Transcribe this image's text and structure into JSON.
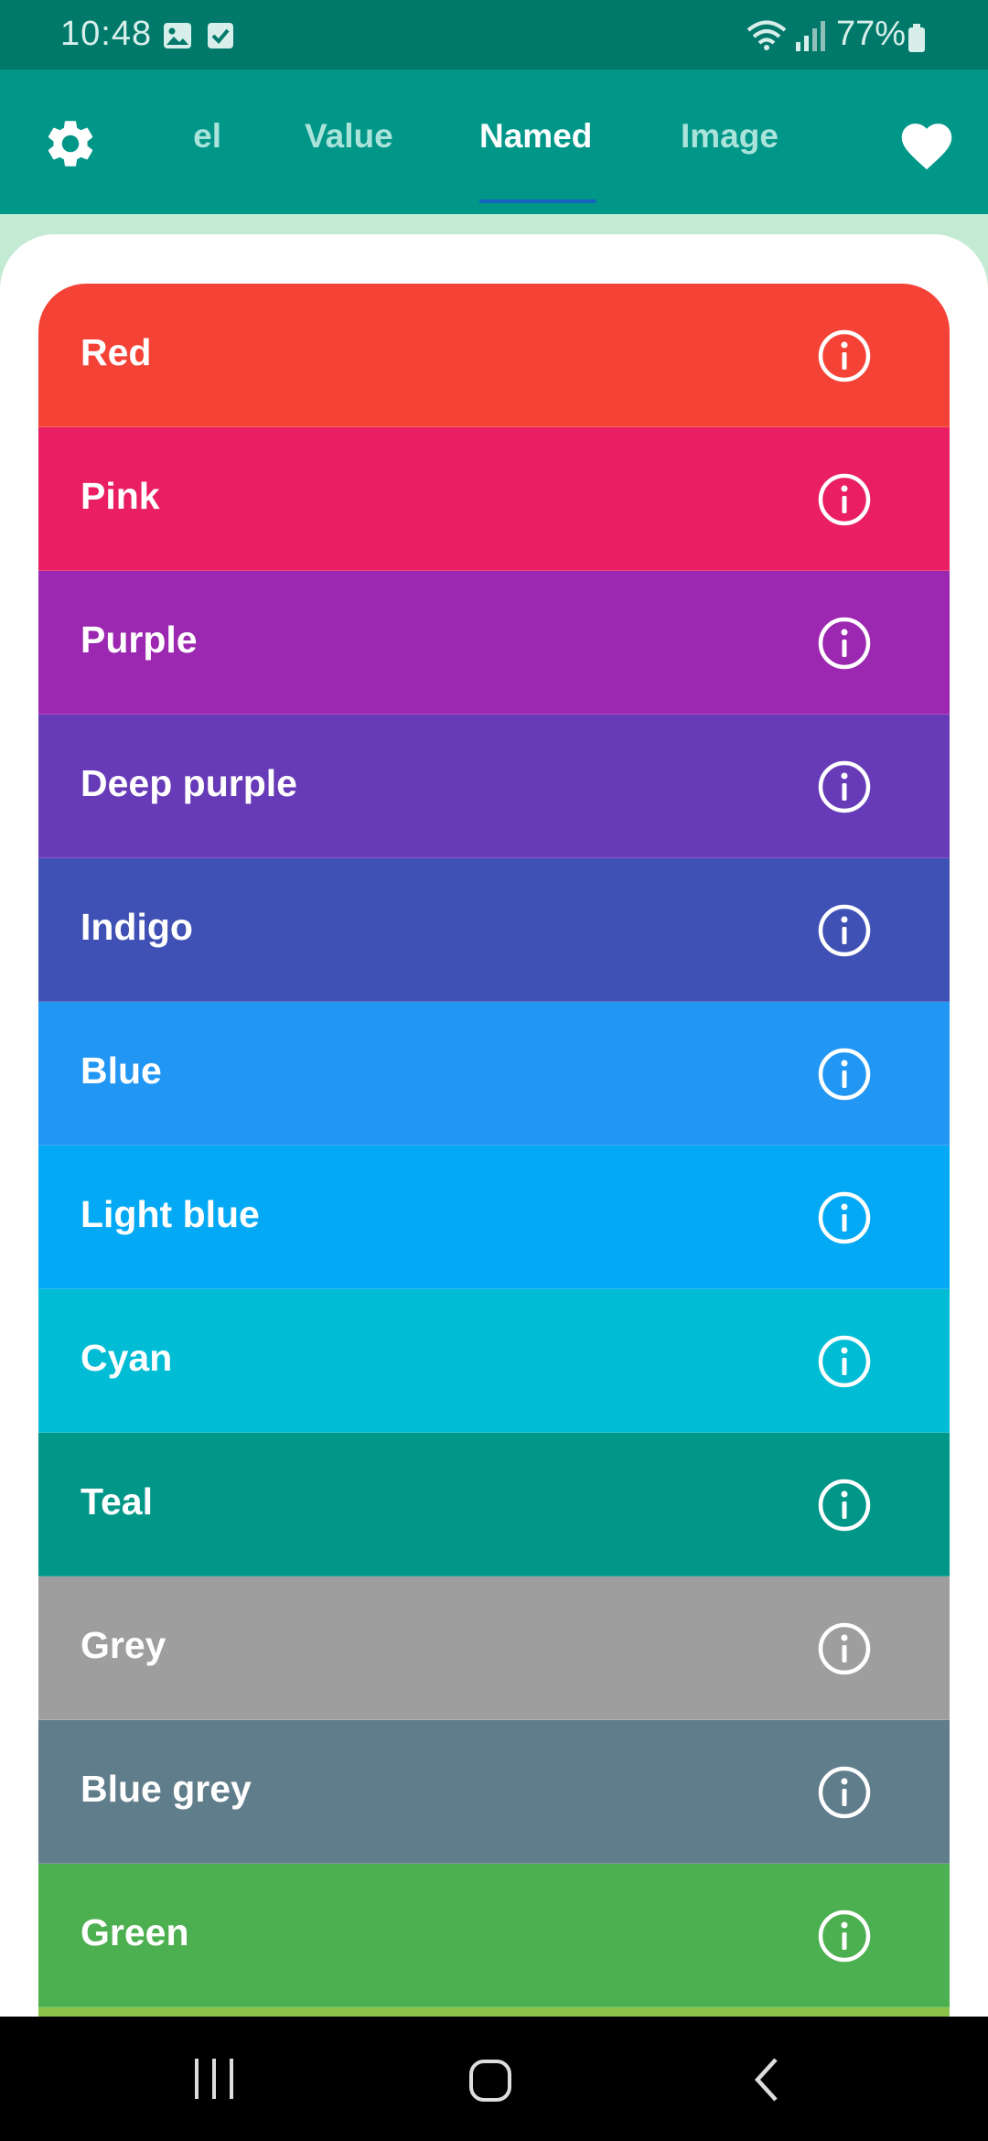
{
  "status_bar": {
    "time": "10:48",
    "battery": "77%",
    "icons": [
      "image-icon",
      "checkbox-icon",
      "wifi-icon",
      "signal-icon",
      "battery-icon"
    ]
  },
  "app_bar": {
    "tabs": [
      {
        "label": "Wheel",
        "visible_text": "el",
        "active": false
      },
      {
        "label": "Value",
        "active": false
      },
      {
        "label": "Named",
        "active": true
      },
      {
        "label": "Image",
        "active": false
      }
    ],
    "icons": [
      "gear-icon",
      "heart-icon"
    ],
    "background": "#009688",
    "indicator_color": "#1565c0"
  },
  "colors": [
    {
      "name": "Red",
      "hex": "#f44336"
    },
    {
      "name": "Pink",
      "hex": "#e91e63"
    },
    {
      "name": "Purple",
      "hex": "#9c27b0"
    },
    {
      "name": "Deep purple",
      "hex": "#673ab7"
    },
    {
      "name": "Indigo",
      "hex": "#3f51b5"
    },
    {
      "name": "Blue",
      "hex": "#2196f3"
    },
    {
      "name": "Light blue",
      "hex": "#03a9f4"
    },
    {
      "name": "Cyan",
      "hex": "#00bcd4"
    },
    {
      "name": "Teal",
      "hex": "#009688"
    },
    {
      "name": "Grey",
      "hex": "#9e9e9e"
    },
    {
      "name": "Blue grey",
      "hex": "#607d8b"
    },
    {
      "name": "Green",
      "hex": "#4caf50"
    },
    {
      "name": "",
      "hex": "#8bc34a"
    }
  ],
  "nav_bar": {
    "icons": [
      "recents-icon",
      "home-icon",
      "back-icon"
    ]
  }
}
